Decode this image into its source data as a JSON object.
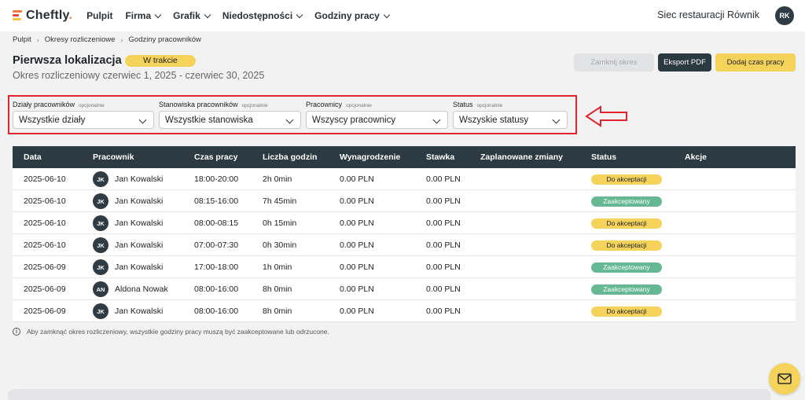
{
  "brand": {
    "name": "Cheftly",
    "dot": "."
  },
  "nav": {
    "items": [
      {
        "label": "Pulpit",
        "dropdown": false
      },
      {
        "label": "Firma",
        "dropdown": true
      },
      {
        "label": "Grafik",
        "dropdown": true
      },
      {
        "label": "Niedostępności",
        "dropdown": true
      },
      {
        "label": "Godziny pracy",
        "dropdown": true
      }
    ],
    "org_name": "Siec restauracji Równik",
    "user_initials": "RK"
  },
  "breadcrumb": [
    "Pulpit",
    "Okresy rozliczeniowe",
    "Godziny pracowników"
  ],
  "header": {
    "title": "Pierwsza lokalizacja",
    "status": "W trakcie",
    "period": "Okres rozliczeniowy czerwiec 1, 2025 - czerwiec 30, 2025"
  },
  "actions": {
    "close_period": "Zamknij okres",
    "export_pdf": "Eksport PDF",
    "add_hours": "Dodaj czas pracy"
  },
  "filters": [
    {
      "label": "Działy pracowników",
      "optional": "opcjonalnie",
      "value": "Wszystkie działy"
    },
    {
      "label": "Stanowiska pracowników",
      "optional": "opcjonalnie",
      "value": "Wszystkie stanowiska"
    },
    {
      "label": "Pracownicy",
      "optional": "opcjonalnie",
      "value": "Wszyscy pracownicy"
    },
    {
      "label": "Status",
      "optional": "opcjonalnie",
      "value": "Wszyskie statusy"
    }
  ],
  "table": {
    "columns": {
      "date": "Data",
      "employee": "Pracownik",
      "time": "Czas pracy",
      "hours": "Liczba godzin",
      "wage": "Wynagrodzenie",
      "rate": "Stawka",
      "planned": "Zaplanowane zmiany",
      "status": "Status",
      "actions": "Akcje"
    },
    "rows": [
      {
        "date": "2025-06-10",
        "initials": "JK",
        "employee": "Jan Kowalski",
        "time": "18:00-20:00",
        "hours": "2h 0min",
        "wage": "0.00 PLN",
        "rate": "0.00 PLN",
        "planned": "",
        "status": "Do akceptacji",
        "status_type": "pending"
      },
      {
        "date": "2025-06-10",
        "initials": "JK",
        "employee": "Jan Kowalski",
        "time": "08:15-16:00",
        "hours": "7h 45min",
        "wage": "0.00 PLN",
        "rate": "0.00 PLN",
        "planned": "",
        "status": "Zaakceptowany",
        "status_type": "accepted"
      },
      {
        "date": "2025-06-10",
        "initials": "JK",
        "employee": "Jan Kowalski",
        "time": "08:00-08:15",
        "hours": "0h 15min",
        "wage": "0.00 PLN",
        "rate": "0.00 PLN",
        "planned": "",
        "status": "Do akceptacji",
        "status_type": "pending"
      },
      {
        "date": "2025-06-10",
        "initials": "JK",
        "employee": "Jan Kowalski",
        "time": "07:00-07:30",
        "hours": "0h 30min",
        "wage": "0.00 PLN",
        "rate": "0.00 PLN",
        "planned": "",
        "status": "Do akceptacji",
        "status_type": "pending"
      },
      {
        "date": "2025-06-09",
        "initials": "JK",
        "employee": "Jan Kowalski",
        "time": "17:00-18:00",
        "hours": "1h 0min",
        "wage": "0.00 PLN",
        "rate": "0.00 PLN",
        "planned": "",
        "status": "Zaakceptowany",
        "status_type": "accepted"
      },
      {
        "date": "2025-06-09",
        "initials": "AN",
        "employee": "Aldona Nowak",
        "time": "08:00-16:00",
        "hours": "8h 0min",
        "wage": "0.00 PLN",
        "rate": "0.00 PLN",
        "planned": "",
        "status": "Zaakceptowany",
        "status_type": "accepted"
      },
      {
        "date": "2025-06-09",
        "initials": "JK",
        "employee": "Jan Kowalski",
        "time": "08:00-16:00",
        "hours": "8h 0min",
        "wage": "0.00 PLN",
        "rate": "0.00 PLN",
        "planned": "",
        "status": "Do akceptacji",
        "status_type": "pending"
      }
    ]
  },
  "note": {
    "icon": "info-icon",
    "glyph": "i",
    "text": "Aby zamknąć okres rozliczeniowy, wszystkie godziny pracy muszą być zaakceptowane lub odrzucone."
  },
  "colors": {
    "accent_yellow": "#f5d35a",
    "dark": "#2c3a41",
    "accepted_green": "#66b894",
    "highlight_red": "#e1232c"
  }
}
